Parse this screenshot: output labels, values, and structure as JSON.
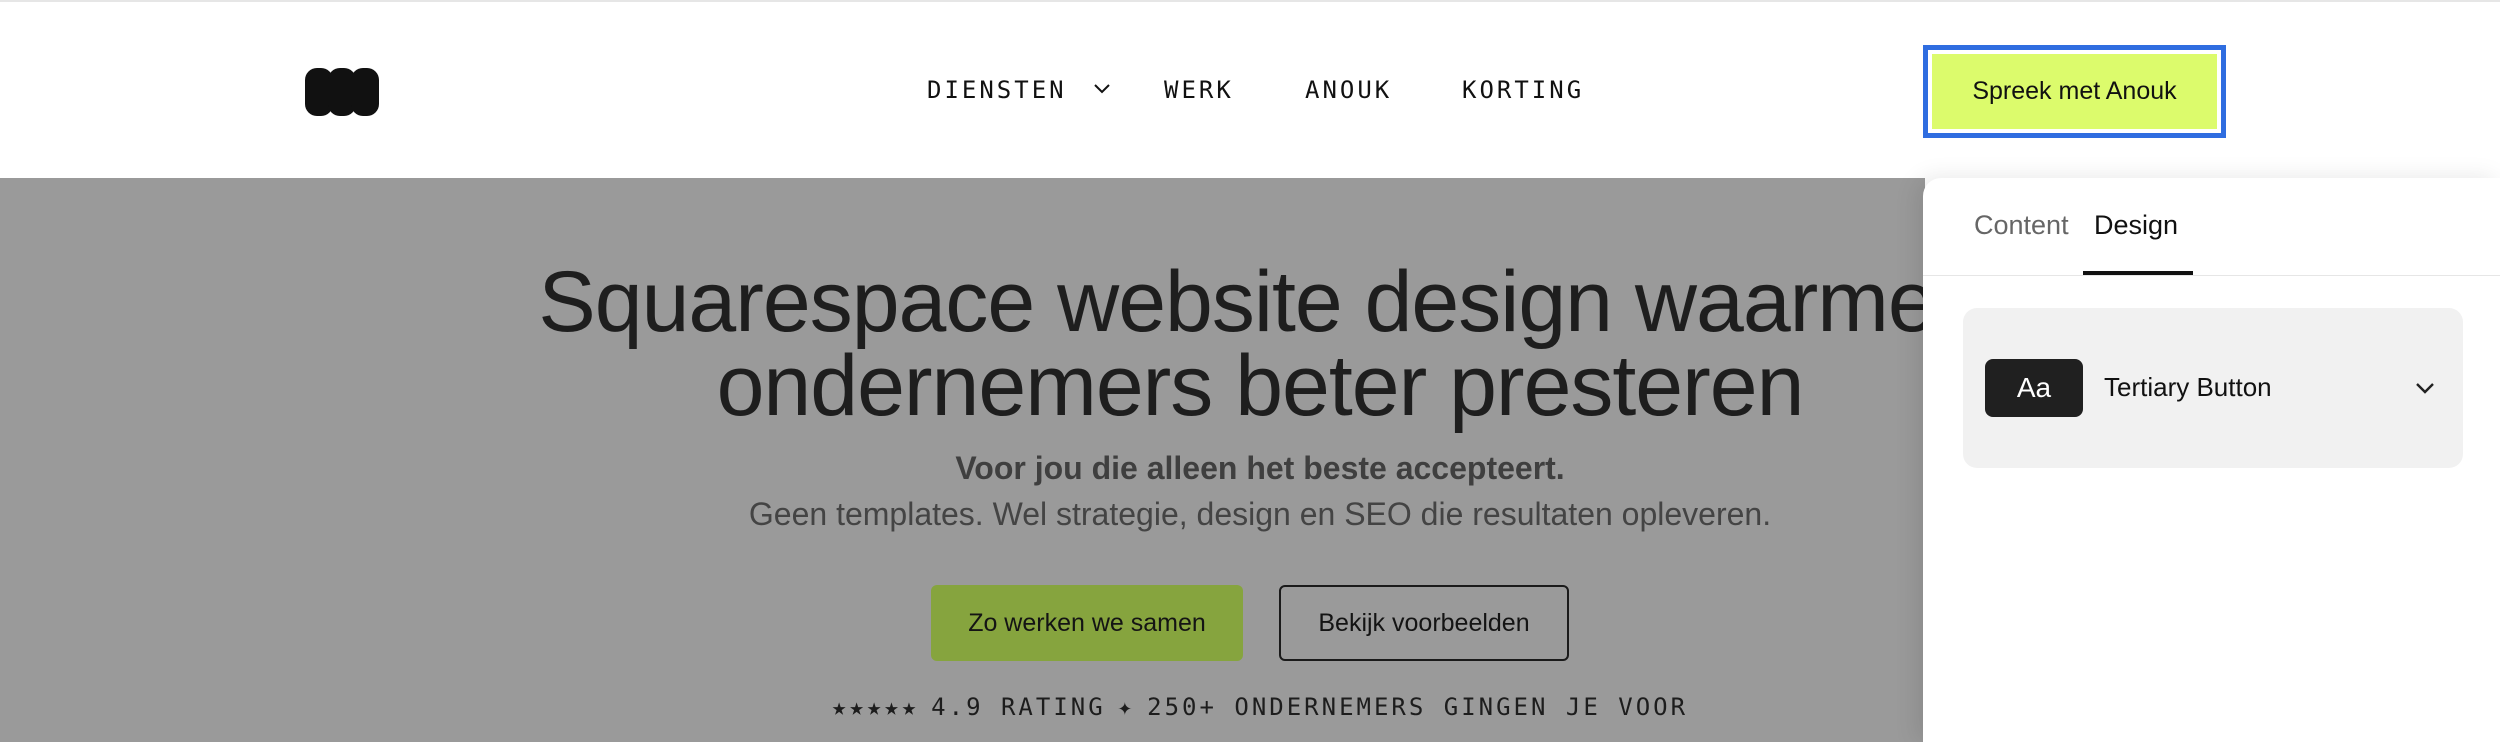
{
  "header": {
    "nav": [
      {
        "label": "DIENSTEN",
        "has_dropdown": true
      },
      {
        "label": "WERK"
      },
      {
        "label": "ANOUK"
      },
      {
        "label": "KORTING"
      }
    ],
    "cta_label": "Spreek met Anouk"
  },
  "hero": {
    "headline_line1": "Squarespace website design waarmee",
    "headline_line2": "ondernemers beter presteren",
    "subheadline_bold": "Voor jou die alleen het beste accepteert.",
    "subheadline": "Geen templates. Wel strategie, design en SEO die resultaten opleveren.",
    "primary_button": "Zo werken we samen",
    "secondary_button": "Bekijk voorbeelden",
    "rating_stars": "★★★★★",
    "rating_text": "4.9 RATING",
    "rating_separator": "✦",
    "rating_customers": "250+ ONDERNEMERS GINGEN JE VOOR"
  },
  "panel": {
    "tabs": [
      {
        "label": "Content",
        "active": false
      },
      {
        "label": "Design",
        "active": true
      }
    ],
    "style_preview": "Aa",
    "style_name": "Tertiary Button"
  },
  "colors": {
    "accent_lime": "#dcfb6c",
    "primary_button": "#86a43e",
    "selection_outline": "#2f6de0",
    "overlay": "#9a9a9a"
  }
}
